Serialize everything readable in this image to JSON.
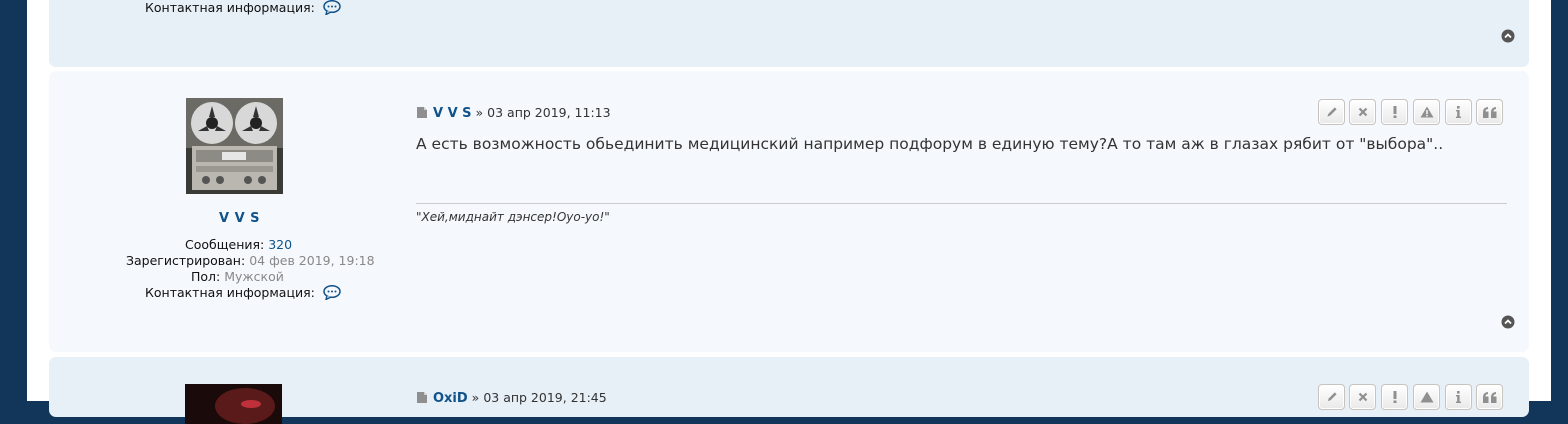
{
  "prev_post": {
    "contact_label": "Контактная информация:",
    "icons": {
      "contact": "chat-bubble-icon",
      "back_to_top": "chevron-up-circle-icon"
    }
  },
  "post": {
    "author": "V V S",
    "separator": "»",
    "date": "03 апр 2019, 11:13",
    "content": "А есть возможность обьединить медицинский например подфорум в единую тему?А то там аж в глазах рябит от \"выбора\"..",
    "signature": "\"Хей,миднайт дэнсер!Оуо-уо!\"",
    "profile": {
      "username": "V V S",
      "posts_label": "Сообщения:",
      "posts_value": "320",
      "registered_label": "Зарегистрирован:",
      "registered_value": "04 фев 2019, 19:18",
      "gender_label": "Пол:",
      "gender_value": "Мужской",
      "contact_label": "Контактная информация:"
    },
    "avatar": "reel-to-reel-tape-recorder",
    "buttons": [
      "edit",
      "delete",
      "report",
      "warn",
      "info",
      "quote"
    ],
    "icons": {
      "post": "file-icon",
      "contact": "chat-bubble-icon",
      "back_to_top": "chevron-up-circle-icon"
    }
  },
  "next_post": {
    "author": "OxiD",
    "separator": "»",
    "date": "03 апр 2019, 21:45",
    "buttons": [
      "edit",
      "delete",
      "report",
      "warn",
      "info",
      "quote"
    ]
  },
  "colors": {
    "outer_bg": "#12365a",
    "post_bg_1": "#e7eff7",
    "post_bg_2": "#f5f9fd",
    "link": "#105289"
  }
}
